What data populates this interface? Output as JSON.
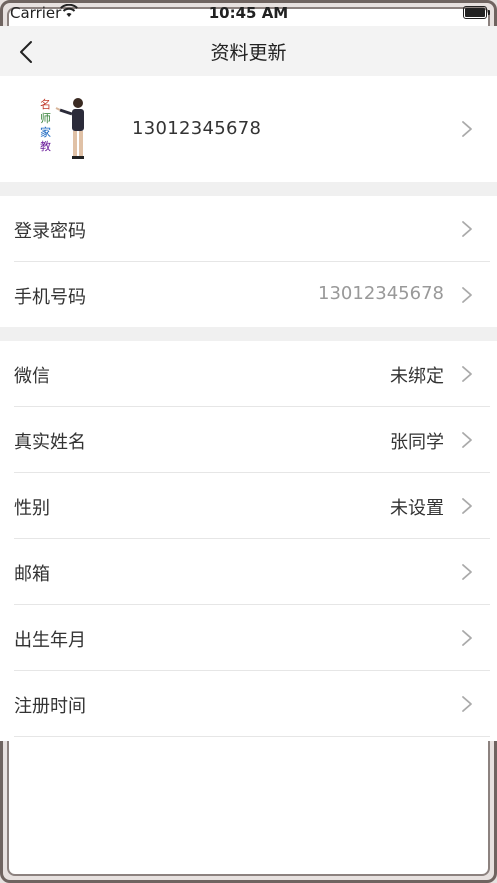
{
  "status_bar": {
    "carrier": "Carrier",
    "time": "10:45 AM"
  },
  "nav": {
    "title": "资料更新",
    "back_icon": "chevron-left-icon"
  },
  "profile": {
    "phone": "13012345678",
    "avatar_logo": "名师家教"
  },
  "account_rows": [
    {
      "label": "登录密码",
      "value": ""
    },
    {
      "label": "手机号码",
      "value": "13012345678"
    }
  ],
  "info_rows": [
    {
      "label": "微信",
      "value": "未绑定"
    },
    {
      "label": "真实姓名",
      "value": "张同学"
    },
    {
      "label": "性别",
      "value": "未设置"
    },
    {
      "label": "邮箱",
      "value": ""
    },
    {
      "label": "出生年月",
      "value": ""
    },
    {
      "label": "注册时间",
      "value": ""
    }
  ],
  "colors": {
    "nav_bg": "#f3f3f3",
    "section_gap": "#f0f0f0",
    "muted_text": "#999999",
    "frame": "#6f6460"
  }
}
